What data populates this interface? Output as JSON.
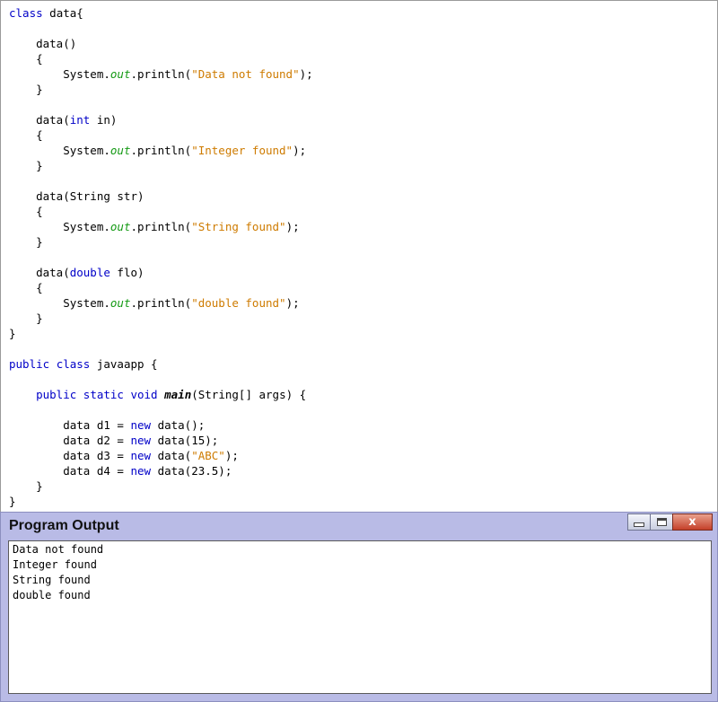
{
  "code": [
    [
      {
        "t": "class",
        "c": "k"
      },
      {
        "t": " data{"
      }
    ],
    [],
    [
      {
        "t": "    data()"
      }
    ],
    [
      {
        "t": "    {"
      }
    ],
    [
      {
        "t": "        System."
      },
      {
        "t": "out",
        "c": "f"
      },
      {
        "t": ".println("
      },
      {
        "t": "\"Data not found\"",
        "c": "s"
      },
      {
        "t": ");"
      }
    ],
    [
      {
        "t": "    }"
      }
    ],
    [],
    [
      {
        "t": "    data("
      },
      {
        "t": "int",
        "c": "k"
      },
      {
        "t": " in)"
      }
    ],
    [
      {
        "t": "    {"
      }
    ],
    [
      {
        "t": "        System."
      },
      {
        "t": "out",
        "c": "f"
      },
      {
        "t": ".println("
      },
      {
        "t": "\"Integer found\"",
        "c": "s"
      },
      {
        "t": ");"
      }
    ],
    [
      {
        "t": "    }"
      }
    ],
    [],
    [
      {
        "t": "    data(String str)"
      }
    ],
    [
      {
        "t": "    {"
      }
    ],
    [
      {
        "t": "        System."
      },
      {
        "t": "out",
        "c": "f"
      },
      {
        "t": ".println("
      },
      {
        "t": "\"String found\"",
        "c": "s"
      },
      {
        "t": ");"
      }
    ],
    [
      {
        "t": "    }"
      }
    ],
    [],
    [
      {
        "t": "    data("
      },
      {
        "t": "double",
        "c": "k"
      },
      {
        "t": " flo)"
      }
    ],
    [
      {
        "t": "    {"
      }
    ],
    [
      {
        "t": "        System."
      },
      {
        "t": "out",
        "c": "f"
      },
      {
        "t": ".println("
      },
      {
        "t": "\"double found\"",
        "c": "s"
      },
      {
        "t": ");"
      }
    ],
    [
      {
        "t": "    }"
      }
    ],
    [
      {
        "t": "}"
      }
    ],
    [],
    [
      {
        "t": "public",
        "c": "k"
      },
      {
        "t": " "
      },
      {
        "t": "class",
        "c": "k"
      },
      {
        "t": " javaapp {"
      }
    ],
    [],
    [
      {
        "t": "    "
      },
      {
        "t": "public",
        "c": "k"
      },
      {
        "t": " "
      },
      {
        "t": "static",
        "c": "k"
      },
      {
        "t": " "
      },
      {
        "t": "void",
        "c": "k"
      },
      {
        "t": " "
      },
      {
        "t": "main",
        "c": "m"
      },
      {
        "t": "(String[] args) {"
      }
    ],
    [],
    [
      {
        "t": "        data d1 = "
      },
      {
        "t": "new",
        "c": "k"
      },
      {
        "t": " data();"
      }
    ],
    [
      {
        "t": "        data d2 = "
      },
      {
        "t": "new",
        "c": "k"
      },
      {
        "t": " data(15);"
      }
    ],
    [
      {
        "t": "        data d3 = "
      },
      {
        "t": "new",
        "c": "k"
      },
      {
        "t": " data("
      },
      {
        "t": "\"ABC\"",
        "c": "s"
      },
      {
        "t": ");"
      }
    ],
    [
      {
        "t": "        data d4 = "
      },
      {
        "t": "new",
        "c": "k"
      },
      {
        "t": " data(23.5);"
      }
    ],
    [
      {
        "t": "    }"
      }
    ],
    [
      {
        "t": "}"
      }
    ]
  ],
  "output_window": {
    "title": "Program Output",
    "close_label": "x",
    "lines": [
      "Data not found",
      "Integer found",
      "String found",
      "double found"
    ]
  },
  "colors": {
    "keyword": "#0000c8",
    "string": "#ce7b00",
    "field": "#159a15",
    "title_bar": "#b9bbe6",
    "close_button": "#c4402a"
  },
  "icons": [
    "minimize-icon",
    "maximize-icon",
    "close-icon"
  ]
}
